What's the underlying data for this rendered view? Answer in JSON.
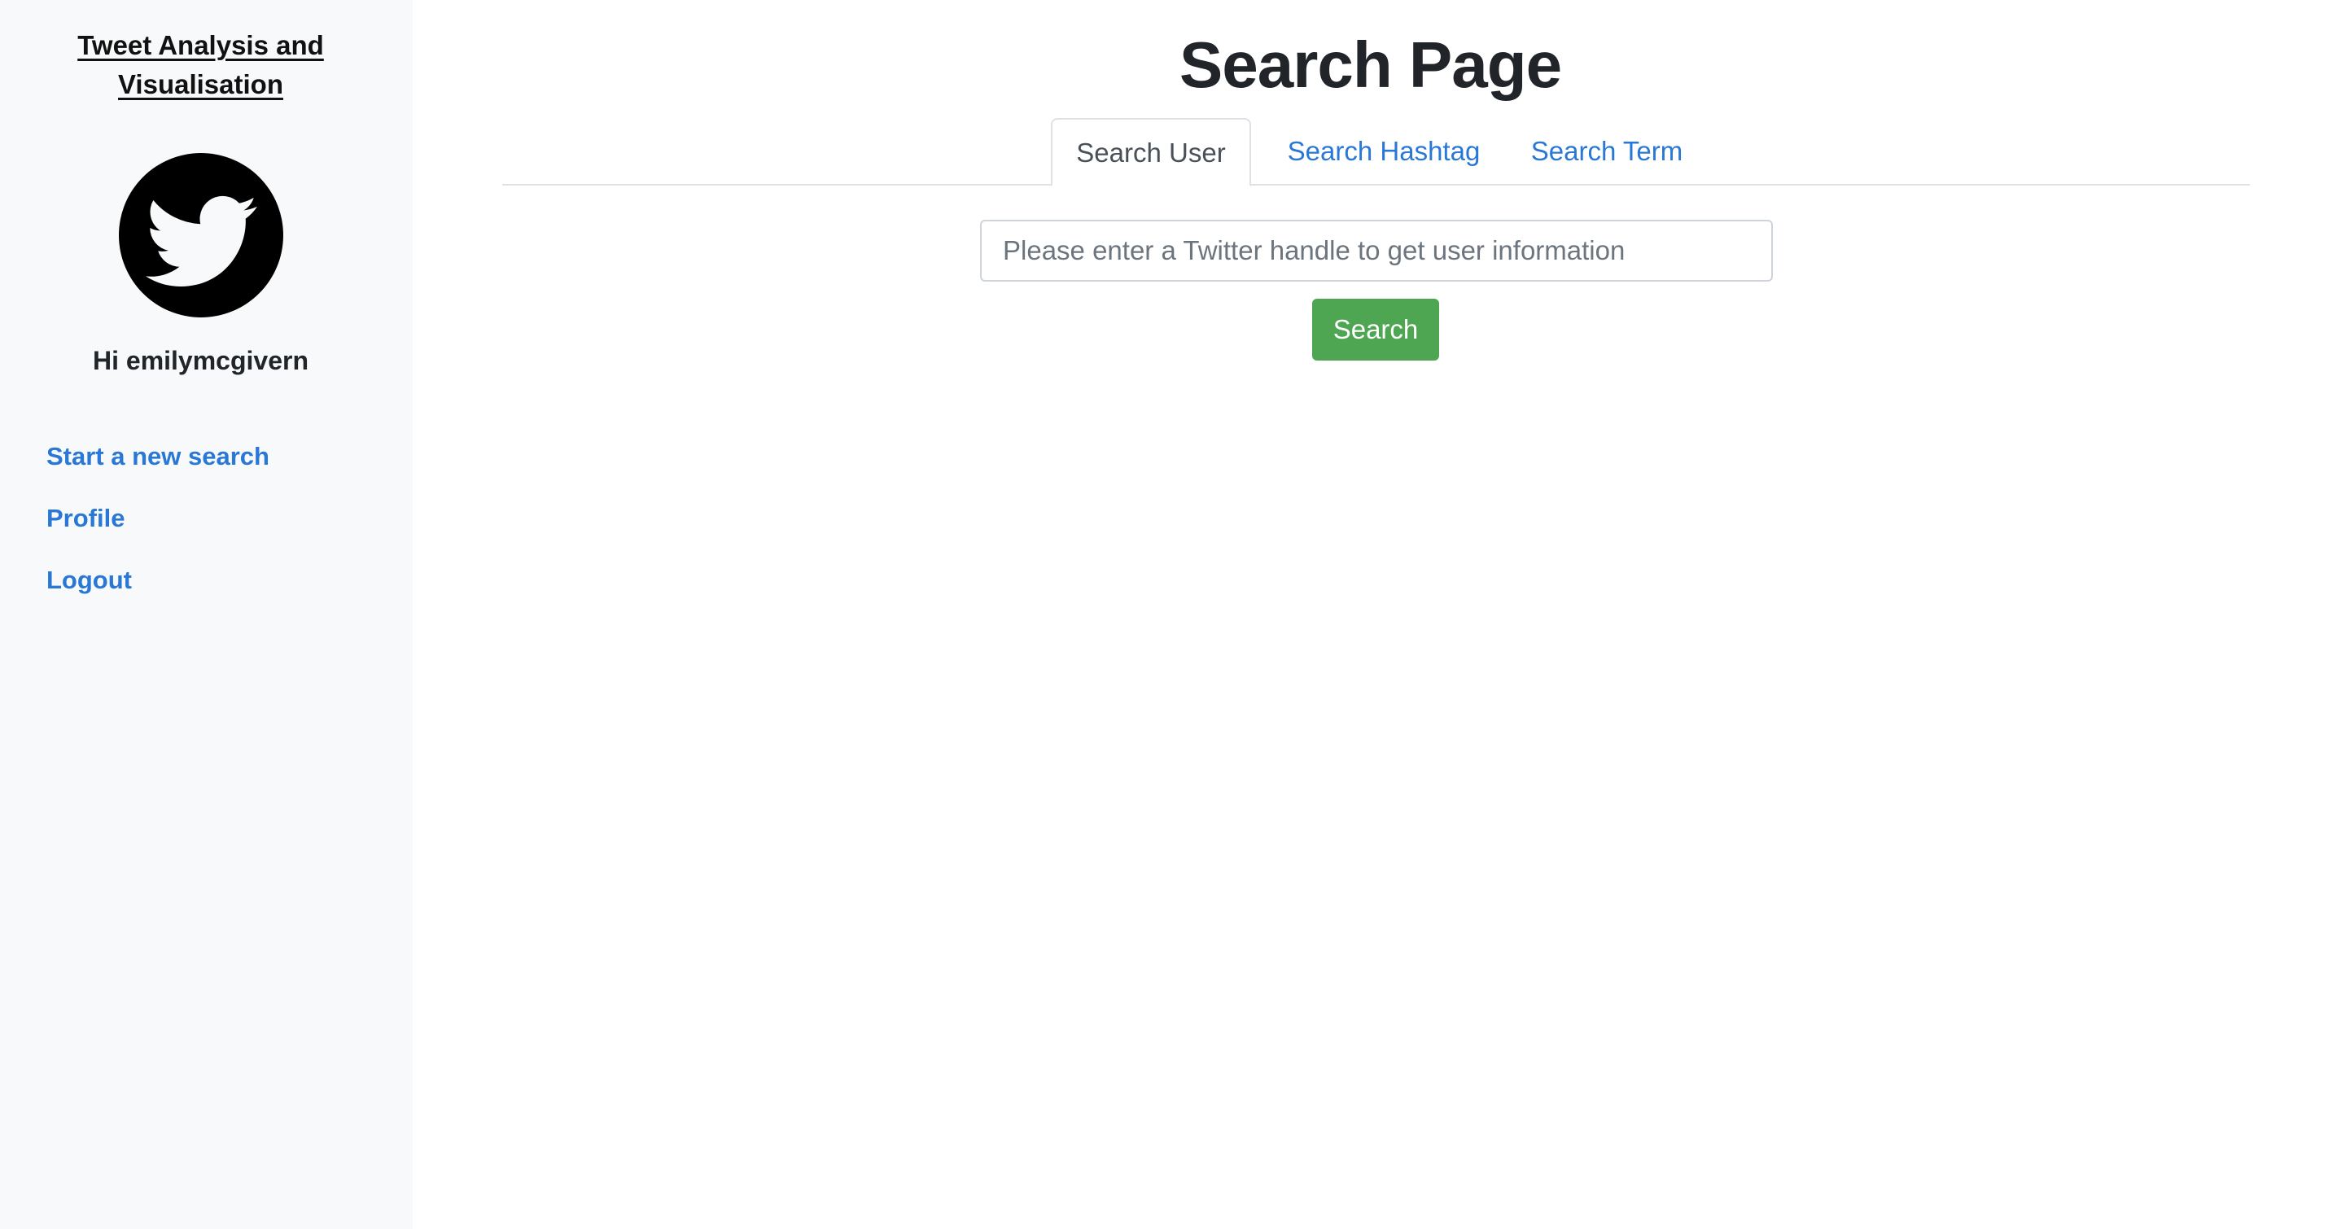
{
  "sidebar": {
    "app_title": "Tweet Analysis and Visualisation",
    "logo_icon": "twitter-bird-icon",
    "greeting": "Hi emilymcgivern",
    "nav": [
      {
        "label": "Start a new search"
      },
      {
        "label": "Profile"
      },
      {
        "label": "Logout"
      }
    ]
  },
  "main": {
    "page_title": "Search Page",
    "tabs": [
      {
        "label": "Search User",
        "active": true
      },
      {
        "label": "Search Hashtag",
        "active": false
      },
      {
        "label": "Search Term",
        "active": false
      }
    ],
    "search": {
      "value": "",
      "placeholder": "Please enter a Twitter handle to get user information",
      "button_label": "Search"
    }
  },
  "colors": {
    "sidebar_bg": "#f8f9fa",
    "link": "#2a78d6",
    "button_bg": "#4ea552",
    "text": "#212529"
  }
}
